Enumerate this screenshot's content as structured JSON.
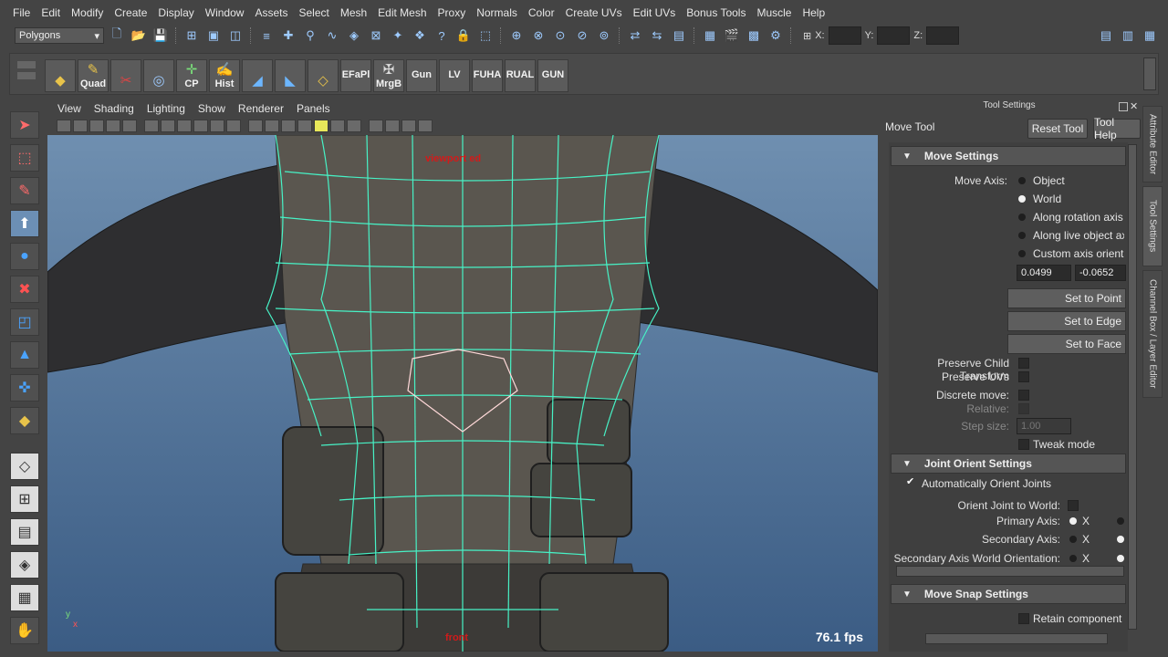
{
  "menubar": [
    "File",
    "Edit",
    "Modify",
    "Create",
    "Display",
    "Window",
    "Assets",
    "Select",
    "Mesh",
    "Edit Mesh",
    "Proxy",
    "Normals",
    "Color",
    "Create UVs",
    "Edit UVs",
    "Bonus Tools",
    "Muscle",
    "Help"
  ],
  "status": {
    "menuset": "Polygons",
    "x_label": "X:",
    "y_label": "Y:",
    "z_label": "Z:"
  },
  "shelf": {
    "buttons": [
      "",
      "Quad",
      "",
      "",
      "CP",
      "Hist",
      "",
      "",
      "",
      "EFaPl",
      "MrgB",
      "Gun",
      "LV",
      "FUHA",
      "RUAL",
      "GUN"
    ]
  },
  "viewport": {
    "menu": [
      "View",
      "Shading",
      "Lighting",
      "Show",
      "Renderer",
      "Panels"
    ],
    "label": "viewport ed",
    "camera": "front",
    "fps": "76.1 fps",
    "axis_y": "y",
    "axis_x": "x"
  },
  "toolsettings": {
    "header": "Tool Settings",
    "tool_name": "Move Tool",
    "reset": "Reset Tool",
    "help": "Tool Help",
    "move_settings": "Move Settings",
    "move_axis_label": "Move Axis:",
    "axes": [
      "Object",
      "World",
      "Along rotation axis",
      "Along live object axis",
      "Custom axis orientat"
    ],
    "selected_axis": "World",
    "custom_a": "0.0499",
    "custom_b": "-0.0652",
    "set_point": "Set to Point",
    "set_edge": "Set to Edge",
    "set_face": "Set to Face",
    "preserve_child": "Preserve Child Transform",
    "preserve_uvs": "Preserve UVs",
    "discrete": "Discrete move:",
    "relative": "Relative:",
    "step_size": "Step size:",
    "step_value": "1.00",
    "tweak": "Tweak mode",
    "joint_orient": "Joint Orient Settings",
    "auto_orient": "Automatically Orient Joints",
    "orient_world": "Orient Joint to World:",
    "primary_axis": "Primary Axis:",
    "secondary_axis": "Secondary Axis:",
    "secondary_world": "Secondary Axis World Orientation:",
    "axis_x": "X",
    "move_snap": "Move Snap Settings",
    "retain": "Retain component sp"
  },
  "righttabs": [
    "Attribute Editor",
    "Tool Settings",
    "Channel Box / Layer Editor"
  ]
}
